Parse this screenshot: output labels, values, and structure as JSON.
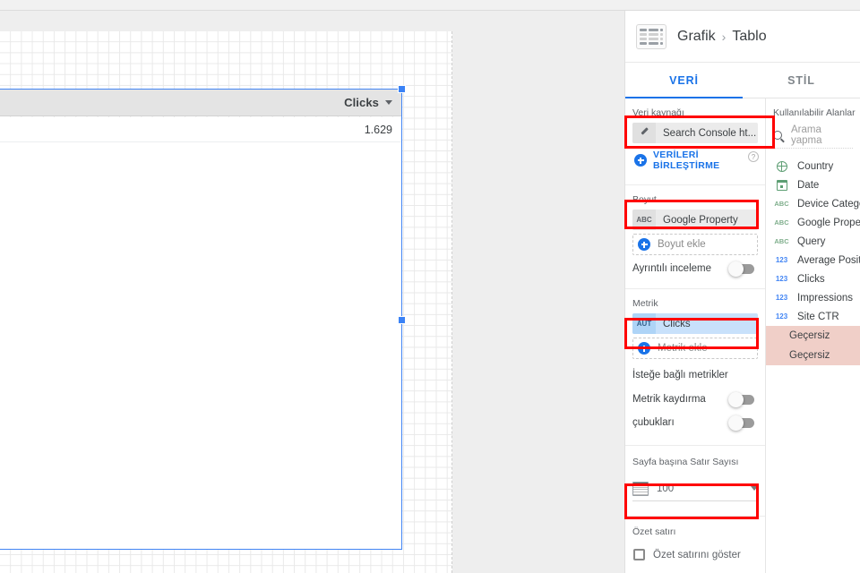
{
  "header": {
    "icon": "table-chart-icon",
    "breadcrumb_root": "Grafik",
    "breadcrumb_sep": "›",
    "breadcrumb_leaf": "Tablo"
  },
  "tabs": [
    {
      "label": "VERİ",
      "active": true
    },
    {
      "label": "STİL",
      "active": false
    }
  ],
  "properties": {
    "data_source": {
      "section_label": "Veri kaynağı",
      "chip_icon": "pencil-icon",
      "chip_label": "Search Console ht...",
      "blend_icon": "plus-circle-icon",
      "blend_label": "VERİLERİ BİRLEŞTİRME",
      "help_icon": "help-icon",
      "help_glyph": "?"
    },
    "dimension": {
      "section_label": "Boyut",
      "chip_icon_text": "ABC",
      "chip_label": "Google Property",
      "add_label": "Boyut ekle"
    },
    "drilldown": {
      "label": "Ayrıntılı inceleme",
      "state": "off"
    },
    "metric": {
      "section_label": "Metrik",
      "chip_icon_text": "AUT",
      "chip_label": "Clicks",
      "add_label": "Metrik ekle"
    },
    "optional_metrics": {
      "label": "İsteğe bağlı metrikler"
    },
    "metric_sliders": {
      "label_line1": "Metrik kaydırma",
      "label_line2": "çubukları",
      "state": "off"
    },
    "rows_per_page": {
      "section_label": "Sayfa başına Satır Sayısı",
      "icon": "rows-icon",
      "value": "100",
      "caret": "chevron-down-icon"
    },
    "summary_row": {
      "section_label": "Özet satırı",
      "checkbox_label": "Özet satırını göster",
      "checked": false
    }
  },
  "available_fields": {
    "title": "Kullanılabilir Alanlar",
    "search_icon": "search-icon",
    "search_placeholder": "Arama yapma",
    "items": [
      {
        "name": "Country",
        "type": "geo",
        "icon": "globe-icon"
      },
      {
        "name": "Date",
        "type": "date",
        "icon": "calendar-icon"
      },
      {
        "name": "Device Categor",
        "type": "text",
        "icon": "abc-icon"
      },
      {
        "name": "Google Propert",
        "type": "text",
        "icon": "abc-icon"
      },
      {
        "name": "Query",
        "type": "text",
        "icon": "abc-icon"
      },
      {
        "name": "Average Positio",
        "type": "number",
        "icon": "123-icon"
      },
      {
        "name": "Clicks",
        "type": "number",
        "icon": "123-icon"
      },
      {
        "name": "Impressions",
        "type": "number",
        "icon": "123-icon"
      },
      {
        "name": "Site CTR",
        "type": "number",
        "icon": "123-icon"
      }
    ],
    "invalid_items": [
      {
        "name": "Geçersiz"
      },
      {
        "name": "Geçersiz"
      }
    ]
  },
  "canvas": {
    "widget": {
      "column_header": "Clicks",
      "sort_icon": "sort-descending-caret",
      "value": "1.629",
      "overflow_icon": "kebab-menu-icon"
    }
  },
  "colors": {
    "accent_blue": "#1a73e8",
    "selection_blue": "#3a82f6",
    "metric_chip": "#c8e1fb",
    "invalid_bg": "#f0cfc8",
    "annotation_red": "#ff0000"
  }
}
